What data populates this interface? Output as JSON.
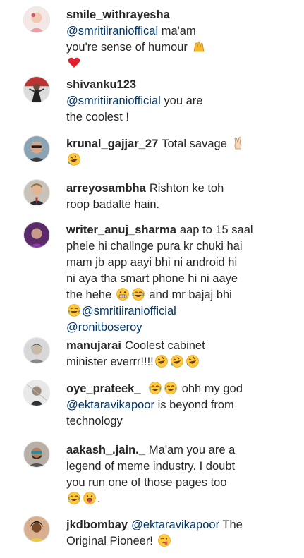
{
  "comments": [
    {
      "user": "smile_withrayesha",
      "l1": "ma'am",
      "mention": "@smritiiranioffical",
      "l1b": "you're sense of humour"
    },
    {
      "user": "shivanku123",
      "mention": "@smritiiraniofficial",
      "after": "you are",
      "l2": "the coolest !"
    },
    {
      "user": "krunal_gajjar_27",
      "text": "Total savage"
    },
    {
      "user": "arreyosambha",
      "text": "Rishton ke toh",
      "l2": "roop badalte hain."
    },
    {
      "user": "writer_anuj_sharma",
      "text": "aap to 15 saal",
      "l2": "phele hi challnge pura kr chuki hai",
      "l3": "mam jb app aayi bhi ni android hi",
      "l4": "ni aya tha smart phone hi ni aaye",
      "l5": "the hehe",
      "l5b": "and mr bajaj bhi",
      "mention1": "@smritiiraniofficial",
      "mention2": "@ronitboseroy"
    },
    {
      "user": "manujarai",
      "text": "Coolest cabinet",
      "l2": "minister everrr!!!!"
    },
    {
      "user": "oye_prateek_",
      "text": "ohh my god",
      "mention": "@ektaravikapoor",
      "after": "is beyond from",
      "l3": "technology"
    },
    {
      "user": "aakash_.jain._",
      "text": "Ma'am you are a",
      "l2": "legend of meme industry. I doubt",
      "l3": "you run one of those pages too"
    },
    {
      "user": "jkdbombay",
      "mention": "@ektaravikapoor",
      "after": "The",
      "l2": "Original Pioneer!"
    }
  ],
  "fix": {
    "c0_mention": "@smritiiranioffical"
  }
}
